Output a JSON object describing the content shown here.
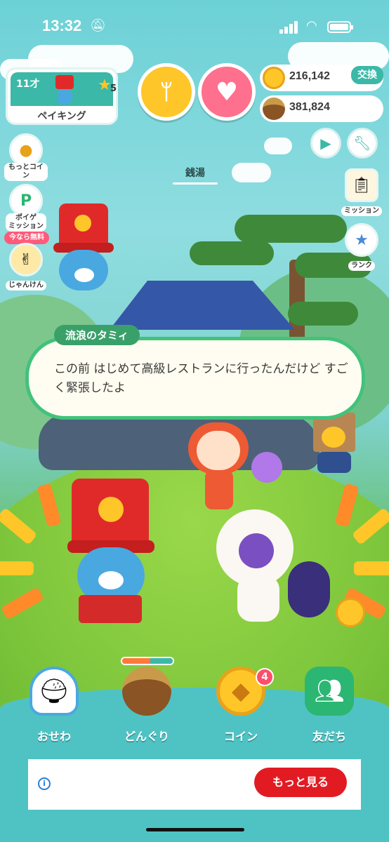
{
  "status_bar": {
    "time": "13:32"
  },
  "profile": {
    "age": "11才",
    "level": "5",
    "name": "ペイキング"
  },
  "currency": {
    "coins": "216,142",
    "acorns": "381,824",
    "exchange_label": "交換"
  },
  "left_menu": {
    "more_coins": "もっとコイン",
    "poige_mission": "ポイゲ\nミッション",
    "free_badge": "今なら無料",
    "janken": "じゃんけん"
  },
  "right_menu": {
    "mission": "ミッション",
    "rank": "ランク"
  },
  "location": "銭湯",
  "dialog": {
    "speaker": "流浪のタミィ",
    "message": "この前 はじめて高級レストランに行ったんだけど すごく緊張したよ"
  },
  "bottom_nav": {
    "items": [
      {
        "label": "おせわ",
        "icon": "rice-bowl-icon"
      },
      {
        "label": "どんぐり",
        "icon": "acorn-icon"
      },
      {
        "label": "コイン",
        "icon": "coin-icon",
        "badge": "4"
      },
      {
        "label": "友だち",
        "icon": "friends-icon"
      }
    ],
    "acorn_gauge": {
      "orange_fraction": 0.55,
      "teal_fraction": 0.45
    }
  },
  "ad": {
    "more_label": "もっと見る",
    "info_icon": "info-icon"
  },
  "colors": {
    "teal": "#3bb8a8",
    "food_button": "#ffc629",
    "heart_button": "#ff6f8e",
    "speech_border": "#42c27b"
  }
}
